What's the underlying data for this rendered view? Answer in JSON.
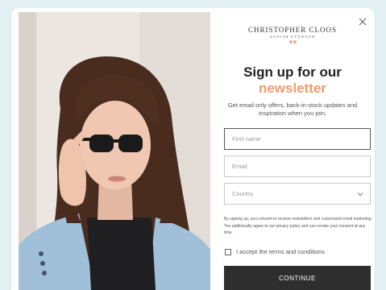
{
  "brand": {
    "name": "CHRISTOPHER CLOOS",
    "subtitle": "DANISH EYEWEAR"
  },
  "headline": {
    "line1": "Sign up for our",
    "accent": "newsletter",
    "accent_color": "#f29a6b"
  },
  "subtext": "Get email only offers, back-in-stock updates and inspiration when you join.",
  "fields": {
    "first_name_placeholder": "First name",
    "email_placeholder": "Email",
    "country_placeholder": "Country"
  },
  "consent_text": "By signing up, you consent to receive newsletters and customized email marketing. You additionally agree to our privacy policy and can revoke your consent at any time.",
  "terms_label": "I accept the terms and conditions",
  "continue_label": "CONTINUE",
  "icons": {
    "close": "close-icon",
    "country_dropdown": "chevron-down-icon"
  },
  "colors": {
    "button_bg": "#2e2e2e",
    "background": "#e3f0f3"
  }
}
